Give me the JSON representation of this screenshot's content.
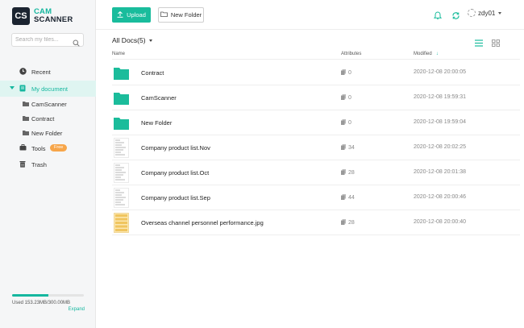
{
  "logo": {
    "mark": "CS",
    "line1": "CAM",
    "line2": "SCANNER"
  },
  "search": {
    "placeholder": "Search my files..."
  },
  "nav": {
    "recent": "Recent",
    "my_document": "My document",
    "sub": [
      "CamScanner",
      "Contract",
      "New Folder"
    ],
    "tools": "Tools",
    "tools_badge": "Free",
    "trash": "Trash"
  },
  "storage": {
    "used_text": "Used 153.23MB/300.00MB",
    "expand": "Expand",
    "used_fraction": 0.51
  },
  "toolbar": {
    "upload": "Upload",
    "new_folder": "New Folder",
    "user": "zdy01"
  },
  "doc_header": {
    "title": "All Docs(5)"
  },
  "columns": {
    "name": "Name",
    "attributes": "Attributes",
    "modified": "Modified",
    "sort_arrow": "↓"
  },
  "rows": [
    {
      "type": "folder",
      "name": "Contract",
      "pages": "0",
      "date": "2020-12-08 20:00:05"
    },
    {
      "type": "folder",
      "name": "CamScanner",
      "pages": "0",
      "date": "2020-12-08 19:59:31"
    },
    {
      "type": "folder",
      "name": "New Folder",
      "pages": "0",
      "date": "2020-12-08 19:59:04"
    },
    {
      "type": "doc",
      "name": "Company product list.Nov",
      "pages": "34",
      "date": "2020-12-08 20:02:25"
    },
    {
      "type": "doc",
      "name": "Company product list.Oct",
      "pages": "28",
      "date": "2020-12-08 20:01:38"
    },
    {
      "type": "doc",
      "name": "Company product list.Sep",
      "pages": "44",
      "date": "2020-12-08 20:00:46"
    },
    {
      "type": "image",
      "name": "Overseas channel personnel performance.jpg",
      "pages": "28",
      "date": "2020-12-08 20:00:40"
    }
  ],
  "colors": {
    "accent": "#19bc9c",
    "badge": "#f7a64a",
    "logo_dark": "#1b2430"
  }
}
